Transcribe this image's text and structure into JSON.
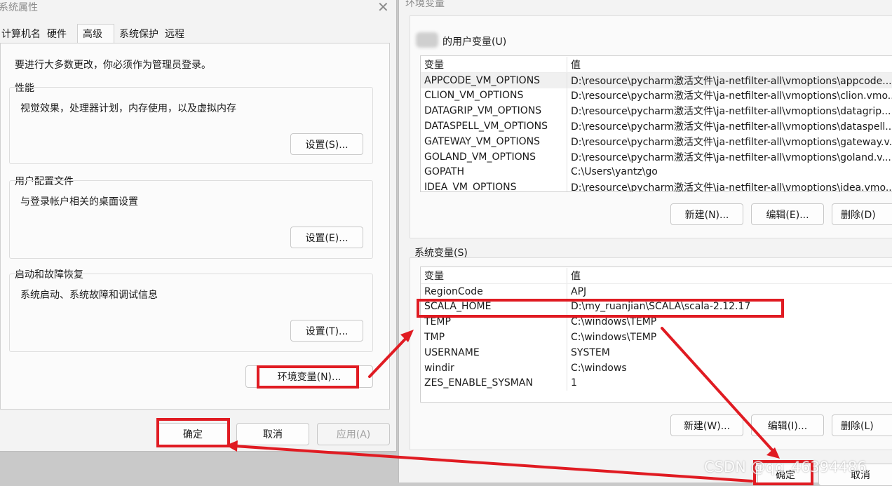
{
  "left_dialog": {
    "title": "系统属性",
    "tabs": [
      "计算机名",
      "硬件",
      "高级",
      "系统保护",
      "远程"
    ],
    "admin_note": "要进行大多数更改，你必须作为管理员登录。",
    "performance": {
      "label": "性能",
      "desc": "视觉效果，处理器计划，内存使用，以及虚拟内存",
      "button": "设置(S)..."
    },
    "user_profile": {
      "label": "用户配置文件",
      "desc": "与登录帐户相关的桌面设置",
      "button": "设置(E)..."
    },
    "startup": {
      "label": "启动和故障恢复",
      "desc": "系统启动、系统故障和调试信息",
      "button": "设置(T)..."
    },
    "env_button": "环境变量(N)...",
    "ok": "确定",
    "cancel": "取消",
    "apply": "应用(A)"
  },
  "right_dialog": {
    "title": "环境变量",
    "user_vars_label": "的用户变量(U)",
    "header": {
      "name": "变量",
      "value": "值"
    },
    "user_vars": [
      {
        "name": "APPCODE_VM_OPTIONS",
        "value": "D:\\resource\\pycharm激活文件\\ja-netfilter-all\\vmoptions\\appcode...."
      },
      {
        "name": "CLION_VM_OPTIONS",
        "value": "D:\\resource\\pycharm激活文件\\ja-netfilter-all\\vmoptions\\clion.vmo..."
      },
      {
        "name": "DATAGRIP_VM_OPTIONS",
        "value": "D:\\resource\\pycharm激活文件\\ja-netfilter-all\\vmoptions\\datagrip...."
      },
      {
        "name": "DATASPELL_VM_OPTIONS",
        "value": "D:\\resource\\pycharm激活文件\\ja-netfilter-all\\vmoptions\\dataspell...."
      },
      {
        "name": "GATEWAY_VM_OPTIONS",
        "value": "D:\\resource\\pycharm激活文件\\ja-netfilter-all\\vmoptions\\gateway.v..."
      },
      {
        "name": "GOLAND_VM_OPTIONS",
        "value": "D:\\resource\\pycharm激活文件\\ja-netfilter-all\\vmoptions\\goland.v..."
      },
      {
        "name": "GOPATH",
        "value": "C:\\Users\\yantz\\go"
      },
      {
        "name": "IDEA_VM_OPTIONS",
        "value": "D:\\resource\\pycharm激活文件\\ja-netfilter-all\\vmoptions\\idea.vmo..."
      }
    ],
    "user_buttons": {
      "new": "新建(N)...",
      "edit": "编辑(E)...",
      "delete": "删除(D)"
    },
    "system_vars_label": "系统变量(S)",
    "system_vars": [
      {
        "name": "RegionCode",
        "value": "APJ"
      },
      {
        "name": "SCALA_HOME",
        "value": "D:\\my_ruanjian\\SCALA\\scala-2.12.17"
      },
      {
        "name": "TEMP",
        "value": "C:\\windows\\TEMP"
      },
      {
        "name": "TMP",
        "value": "C:\\windows\\TEMP"
      },
      {
        "name": "USERNAME",
        "value": "SYSTEM"
      },
      {
        "name": "windir",
        "value": "C:\\windows"
      },
      {
        "name": "ZES_ENABLE_SYSMAN",
        "value": "1"
      }
    ],
    "system_buttons": {
      "new": "新建(W)...",
      "edit": "编辑(I)...",
      "delete": "删除(L)"
    },
    "ok": "确定",
    "cancel": "取消"
  },
  "watermark": "CSDN @qq_46394486",
  "colors": {
    "annotation_red": "#e01b22",
    "dialog_bg": "#f3f3f3",
    "list_bg": "#ffffff"
  }
}
